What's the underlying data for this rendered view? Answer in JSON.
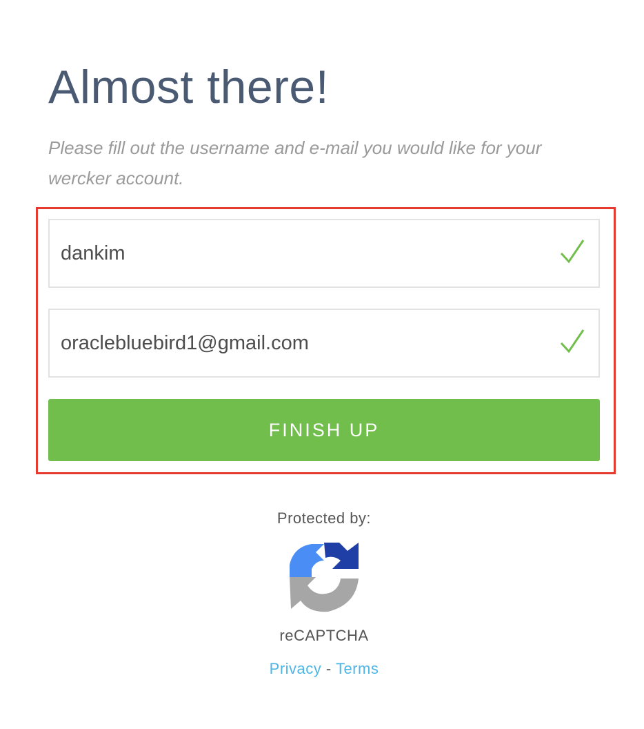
{
  "header": {
    "title": "Almost there!",
    "subtitle": "Please fill out the username and e-mail you would like for your wercker account."
  },
  "form": {
    "username_value": "dankim",
    "email_value": "oraclebluebird1@gmail.com",
    "submit_label": "FINISH UP"
  },
  "footer": {
    "protected_by": "Protected by:",
    "recaptcha_label": "reCAPTCHA",
    "privacy_label": "Privacy",
    "separator": " - ",
    "terms_label": "Terms"
  },
  "colors": {
    "title": "#4a5a73",
    "valid_check": "#71be4c",
    "button": "#71be4c",
    "highlight": "#e53a2f",
    "link": "#4db6e6"
  },
  "icons": {
    "field_status": "checkmark-icon",
    "captcha": "recaptcha-logo-icon"
  }
}
